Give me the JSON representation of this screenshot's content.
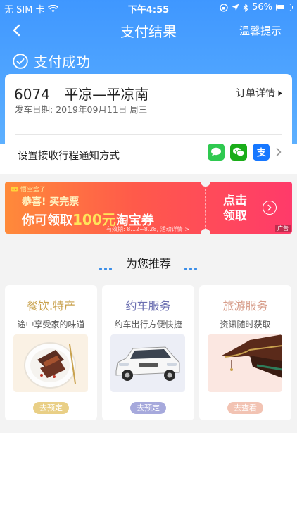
{
  "status_bar": {
    "carrier": "无 SIM 卡",
    "time": "下午4:55",
    "battery": "56%",
    "battery_level": 0.56
  },
  "nav": {
    "title": "支付结果",
    "tip": "温馨提示"
  },
  "result": {
    "text": "支付成功"
  },
  "trip": {
    "train_no": "6074",
    "route": "平凉—平凉南",
    "order_link": "订单详情",
    "date_label": "发车日期:",
    "date_value": "2019年09月11日 周三",
    "notify_label": "设置接收行程通知方式",
    "notify_icons": [
      "sms-icon",
      "wechat-icon",
      "alipay-icon"
    ]
  },
  "banner": {
    "brand": "悟空盒子",
    "line1": "恭喜! 买完票",
    "line2_pre": "你可领取",
    "line2_amount": "100元",
    "line2_post": "淘宝券",
    "validity": "有效期: 8.12~8.28, 活动详情 >",
    "cta_line1": "点击",
    "cta_line2": "领取",
    "ad_tag": "广告"
  },
  "recommend": {
    "title": "为您推荐",
    "cards": [
      {
        "title": "餐饮.特产",
        "desc": "途中享受家的味道",
        "button": "去预定",
        "title_color": "#c9a24e",
        "button_color": "#e9cf86"
      },
      {
        "title": "约车服务",
        "desc": "约车出行方便快捷",
        "button": "去预定",
        "title_color": "#6b6fb1",
        "button_color": "#a6a9dc"
      },
      {
        "title": "旅游服务",
        "desc": "资讯随时获取",
        "button": "去查看",
        "title_color": "#d79d8a",
        "button_color": "#f2c3b3"
      }
    ]
  },
  "colors": {
    "primary": "#3f97ff",
    "accent_dot": "#3a8de8"
  }
}
